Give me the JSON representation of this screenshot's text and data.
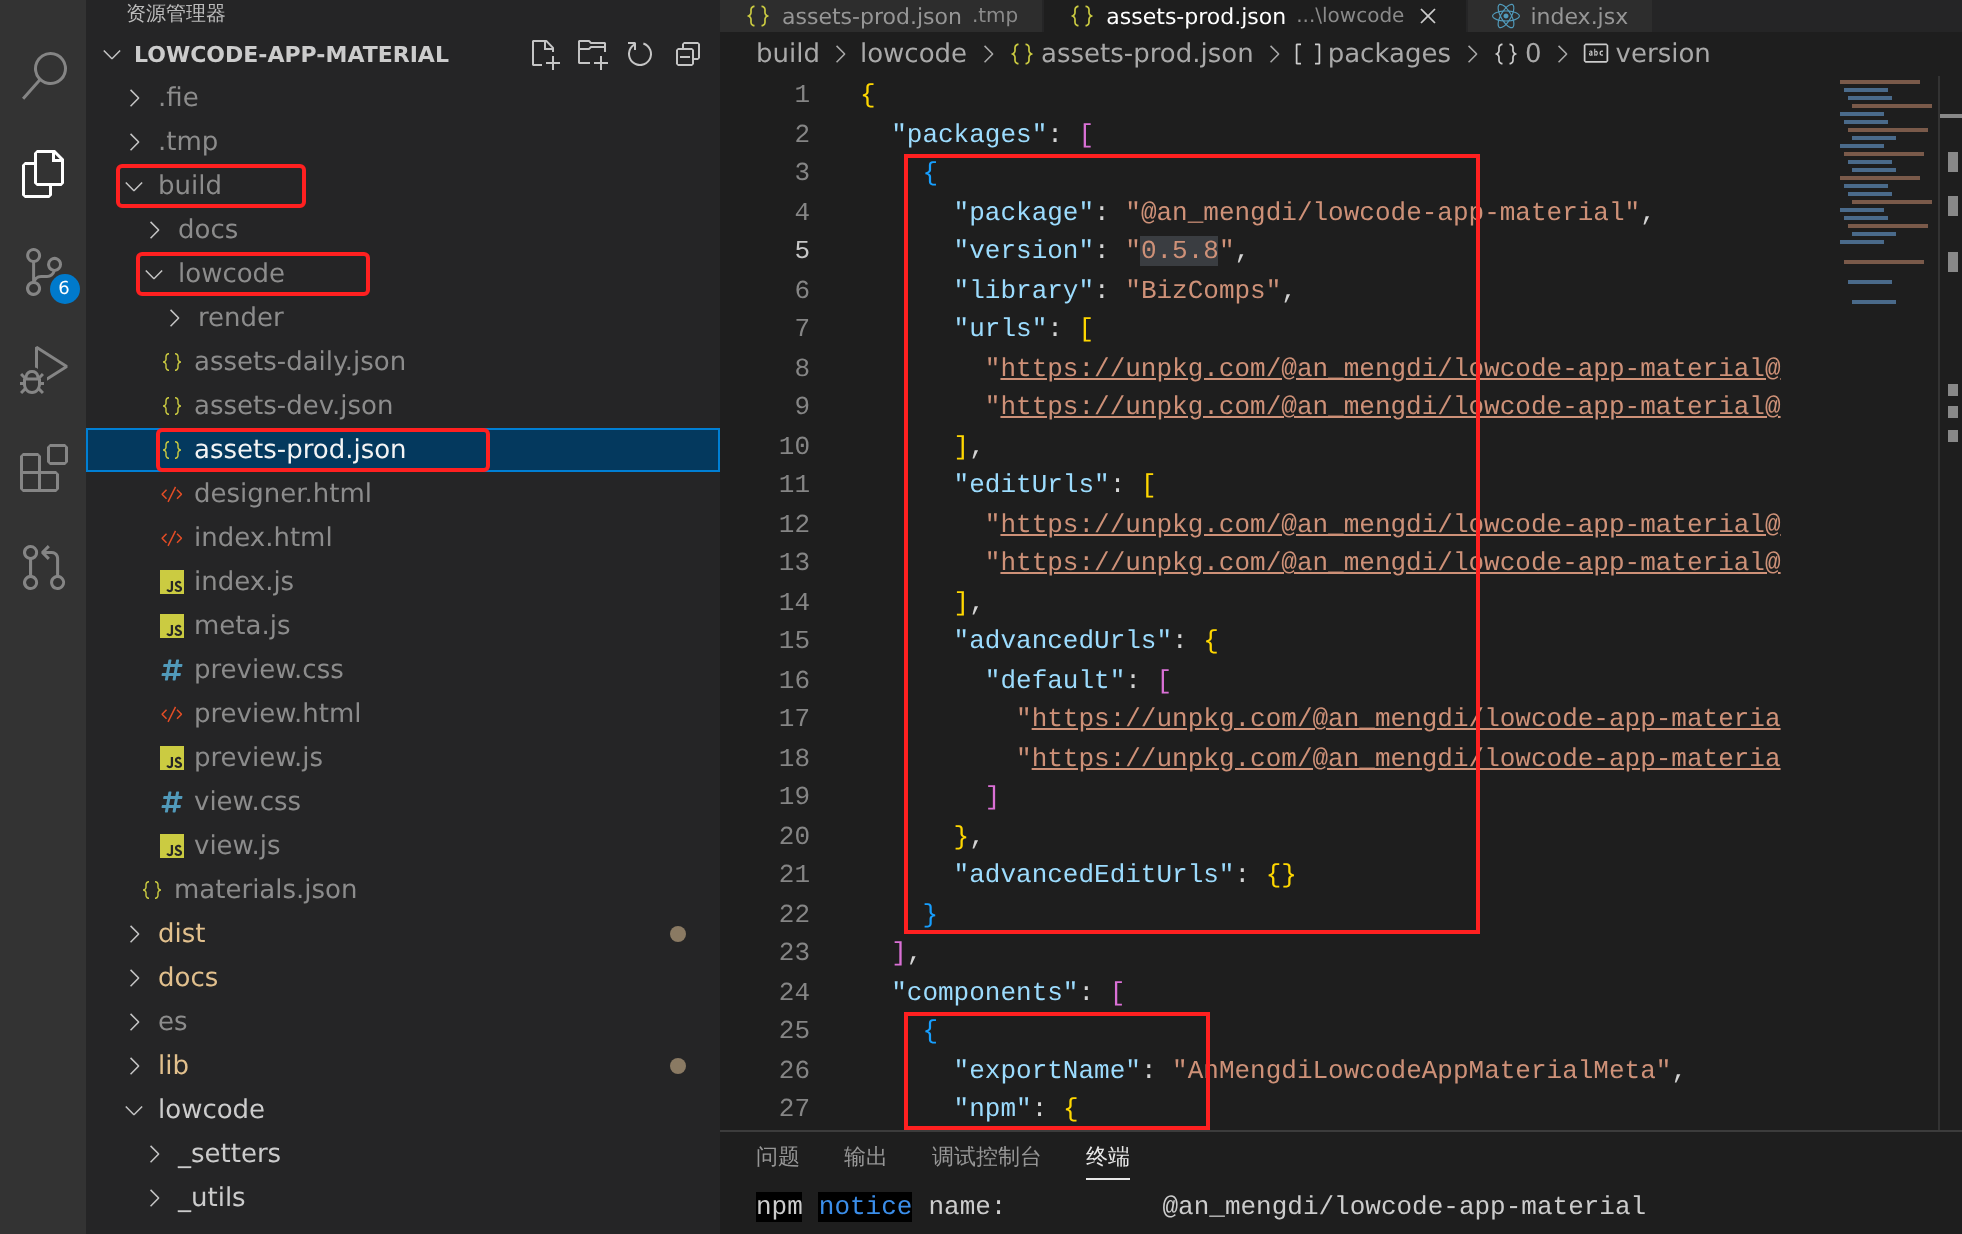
{
  "sidebar": {
    "title": "资源管理器",
    "project": "LOWCODE-APP-MATERIAL",
    "tree": [
      {
        "name": ".fie",
        "kind": "folder",
        "expanded": false,
        "greyed": true,
        "modified": false,
        "selected": false,
        "framed": false,
        "dot": false
      },
      {
        "name": ".tmp",
        "kind": "folder",
        "expanded": false,
        "greyed": true,
        "modified": false,
        "selected": false,
        "framed": false,
        "dot": false
      },
      {
        "name": "build",
        "kind": "folder",
        "expanded": true,
        "greyed": true,
        "modified": false,
        "selected": false,
        "framed": true,
        "dot": false,
        "children": [
          {
            "name": "docs",
            "kind": "folder",
            "expanded": false,
            "greyed": true,
            "modified": false,
            "selected": false,
            "framed": false,
            "dot": false
          },
          {
            "name": "lowcode",
            "kind": "folder",
            "expanded": true,
            "greyed": true,
            "modified": false,
            "selected": false,
            "framed": true,
            "dot": false,
            "children": [
              {
                "name": "render",
                "kind": "folder",
                "expanded": false,
                "greyed": true,
                "modified": false,
                "selected": false,
                "framed": false,
                "dot": false
              },
              {
                "name": "assets-daily.json",
                "kind": "json",
                "greyed": true,
                "modified": false,
                "selected": false,
                "framed": false,
                "dot": false
              },
              {
                "name": "assets-dev.json",
                "kind": "json",
                "greyed": true,
                "modified": false,
                "selected": false,
                "framed": false,
                "dot": false
              },
              {
                "name": "assets-prod.json",
                "kind": "json",
                "greyed": true,
                "modified": false,
                "selected": true,
                "framed": true,
                "dot": false
              },
              {
                "name": "designer.html",
                "kind": "html",
                "greyed": true,
                "modified": false,
                "selected": false,
                "framed": false,
                "dot": false
              },
              {
                "name": "index.html",
                "kind": "html",
                "greyed": true,
                "modified": false,
                "selected": false,
                "framed": false,
                "dot": false
              },
              {
                "name": "index.js",
                "kind": "js",
                "greyed": true,
                "modified": false,
                "selected": false,
                "framed": false,
                "dot": false
              },
              {
                "name": "meta.js",
                "kind": "js",
                "greyed": true,
                "modified": false,
                "selected": false,
                "framed": false,
                "dot": false
              },
              {
                "name": "preview.css",
                "kind": "css",
                "greyed": true,
                "modified": false,
                "selected": false,
                "framed": false,
                "dot": false
              },
              {
                "name": "preview.html",
                "kind": "html",
                "greyed": true,
                "modified": false,
                "selected": false,
                "framed": false,
                "dot": false
              },
              {
                "name": "preview.js",
                "kind": "js",
                "greyed": true,
                "modified": false,
                "selected": false,
                "framed": false,
                "dot": false
              },
              {
                "name": "view.css",
                "kind": "css",
                "greyed": true,
                "modified": false,
                "selected": false,
                "framed": false,
                "dot": false
              },
              {
                "name": "view.js",
                "kind": "js",
                "greyed": true,
                "modified": false,
                "selected": false,
                "framed": false,
                "dot": false
              }
            ]
          },
          {
            "name": "materials.json",
            "kind": "json",
            "greyed": true,
            "modified": false,
            "selected": false,
            "framed": false,
            "dot": false
          }
        ]
      },
      {
        "name": "dist",
        "kind": "folder",
        "expanded": false,
        "greyed": false,
        "modified": true,
        "selected": false,
        "framed": false,
        "dot": true
      },
      {
        "name": "docs",
        "kind": "folder",
        "expanded": false,
        "greyed": false,
        "modified": true,
        "selected": false,
        "framed": false,
        "dot": false
      },
      {
        "name": "es",
        "kind": "folder",
        "expanded": false,
        "greyed": true,
        "modified": false,
        "selected": false,
        "framed": false,
        "dot": false
      },
      {
        "name": "lib",
        "kind": "folder",
        "expanded": false,
        "greyed": false,
        "modified": true,
        "selected": false,
        "framed": false,
        "dot": true
      },
      {
        "name": "lowcode",
        "kind": "folder",
        "expanded": true,
        "greyed": false,
        "modified": false,
        "selected": false,
        "framed": false,
        "dot": false,
        "children": [
          {
            "name": "_setters",
            "kind": "folder",
            "expanded": false,
            "greyed": false,
            "modified": false,
            "selected": false,
            "framed": false,
            "dot": false
          },
          {
            "name": "_utils",
            "kind": "folder",
            "expanded": false,
            "greyed": false,
            "modified": false,
            "selected": false,
            "framed": false,
            "dot": false
          }
        ]
      }
    ]
  },
  "activity_bar": [
    {
      "kind": "search",
      "selected": false
    },
    {
      "kind": "files",
      "selected": true
    },
    {
      "kind": "source-control",
      "selected": false,
      "badge": "6"
    },
    {
      "kind": "debug",
      "selected": false
    },
    {
      "kind": "extensions",
      "selected": false
    },
    {
      "kind": "git-graph",
      "selected": false
    }
  ],
  "tabs": [
    {
      "kind": "json",
      "label": "assets-prod.json",
      "description": ".tmp",
      "selected": false
    },
    {
      "kind": "json",
      "label": "assets-prod.json",
      "description": "...\\lowcode",
      "selected": true
    },
    {
      "kind": "react",
      "label": "index.jsx",
      "selected": false
    }
  ],
  "breadcrumb": [
    {
      "kind": "folder",
      "label": "build"
    },
    {
      "kind": "folder",
      "label": "lowcode"
    },
    {
      "kind": "json",
      "label": "assets-prod.json"
    },
    {
      "kind": "array",
      "label": "packages"
    },
    {
      "kind": "object",
      "label": "0"
    },
    {
      "kind": "string",
      "label": "version"
    }
  ],
  "code_lines": [
    {
      "number": "1",
      "current": false,
      "framed": false,
      "tokens": [
        {
          "kind": "bracket",
          "text": "{",
          "color": "#ffd700"
        }
      ]
    },
    {
      "number": "2",
      "current": false,
      "framed": false,
      "tokens": [
        {
          "kind": "key",
          "text": "  \"packages\""
        },
        {
          "kind": "punct",
          "text": ": "
        },
        {
          "kind": "bracket",
          "text": "[",
          "color": "#da70d6"
        }
      ]
    },
    {
      "number": "3",
      "current": false,
      "framed": true,
      "tokens": [
        {
          "kind": "bracket",
          "text": "    {",
          "color": "#179fff"
        }
      ]
    },
    {
      "number": "4",
      "current": false,
      "framed": true,
      "tokens": [
        {
          "kind": "key",
          "text": "      \"package\""
        },
        {
          "kind": "punct",
          "text": ": "
        },
        {
          "kind": "string",
          "text": "\"@an_mengdi/lowcode-app-material\""
        },
        {
          "kind": "punct",
          "text": ","
        }
      ]
    },
    {
      "number": "5",
      "current": true,
      "framed": true,
      "tokens": [
        {
          "kind": "key",
          "text": "      \"version\""
        },
        {
          "kind": "punct",
          "text": ": "
        },
        {
          "kind": "string",
          "text": "\""
        },
        {
          "kind": "highlight",
          "text": "0.5.8"
        },
        {
          "kind": "string",
          "text": "\""
        },
        {
          "kind": "punct",
          "text": ","
        }
      ]
    },
    {
      "number": "6",
      "current": false,
      "framed": true,
      "tokens": [
        {
          "kind": "key",
          "text": "      \"library\""
        },
        {
          "kind": "punct",
          "text": ": "
        },
        {
          "kind": "string",
          "text": "\"BizComps\""
        },
        {
          "kind": "punct",
          "text": ","
        }
      ]
    },
    {
      "number": "7",
      "current": false,
      "framed": true,
      "tokens": [
        {
          "kind": "key",
          "text": "      \"urls\""
        },
        {
          "kind": "punct",
          "text": ": "
        },
        {
          "kind": "bracket",
          "text": "[",
          "color": "#ffd700"
        }
      ]
    },
    {
      "number": "8",
      "current": false,
      "framed": true,
      "tokens": [
        {
          "kind": "string",
          "text": "        \""
        },
        {
          "kind": "link",
          "text": "https://unpkg.com/@an_mengdi/lowcode-app-material@"
        }
      ]
    },
    {
      "number": "9",
      "current": false,
      "framed": true,
      "tokens": [
        {
          "kind": "string",
          "text": "        \""
        },
        {
          "kind": "link",
          "text": "https://unpkg.com/@an_mengdi/lowcode-app-material@"
        }
      ]
    },
    {
      "number": "10",
      "current": false,
      "framed": true,
      "tokens": [
        {
          "kind": "bracket",
          "text": "      ]",
          "color": "#ffd700"
        },
        {
          "kind": "punct",
          "text": ","
        }
      ]
    },
    {
      "number": "11",
      "current": false,
      "framed": true,
      "tokens": [
        {
          "kind": "key",
          "text": "      \"editUrls\""
        },
        {
          "kind": "punct",
          "text": ": "
        },
        {
          "kind": "bracket",
          "text": "[",
          "color": "#ffd700"
        }
      ]
    },
    {
      "number": "12",
      "current": false,
      "framed": true,
      "tokens": [
        {
          "kind": "string",
          "text": "        \""
        },
        {
          "kind": "link",
          "text": "https://unpkg.com/@an_mengdi/lowcode-app-material@"
        }
      ]
    },
    {
      "number": "13",
      "current": false,
      "framed": true,
      "tokens": [
        {
          "kind": "string",
          "text": "        \""
        },
        {
          "kind": "link",
          "text": "https://unpkg.com/@an_mengdi/lowcode-app-material@"
        }
      ]
    },
    {
      "number": "14",
      "current": false,
      "framed": true,
      "tokens": [
        {
          "kind": "bracket",
          "text": "      ]",
          "color": "#ffd700"
        },
        {
          "kind": "punct",
          "text": ","
        }
      ]
    },
    {
      "number": "15",
      "current": false,
      "framed": true,
      "tokens": [
        {
          "kind": "key",
          "text": "      \"advancedUrls\""
        },
        {
          "kind": "punct",
          "text": ": "
        },
        {
          "kind": "bracket",
          "text": "{",
          "color": "#ffd700"
        }
      ]
    },
    {
      "number": "16",
      "current": false,
      "framed": true,
      "tokens": [
        {
          "kind": "key",
          "text": "        \"default\""
        },
        {
          "kind": "punct",
          "text": ": "
        },
        {
          "kind": "bracket",
          "text": "[",
          "color": "#da70d6"
        }
      ]
    },
    {
      "number": "17",
      "current": false,
      "framed": true,
      "tokens": [
        {
          "kind": "string",
          "text": "          \""
        },
        {
          "kind": "link",
          "text": "https://unpkg.com/@an_mengdi/lowcode-app-materia"
        }
      ]
    },
    {
      "number": "18",
      "current": false,
      "framed": true,
      "tokens": [
        {
          "kind": "string",
          "text": "          \""
        },
        {
          "kind": "link",
          "text": "https://unpkg.com/@an_mengdi/lowcode-app-materia"
        }
      ]
    },
    {
      "number": "19",
      "current": false,
      "framed": true,
      "tokens": [
        {
          "kind": "bracket",
          "text": "        ]",
          "color": "#da70d6"
        }
      ]
    },
    {
      "number": "20",
      "current": false,
      "framed": true,
      "tokens": [
        {
          "kind": "bracket",
          "text": "      }",
          "color": "#ffd700"
        },
        {
          "kind": "punct",
          "text": ","
        }
      ]
    },
    {
      "number": "21",
      "current": false,
      "framed": true,
      "tokens": [
        {
          "kind": "key",
          "text": "      \"advancedEditUrls\""
        },
        {
          "kind": "punct",
          "text": ": "
        },
        {
          "kind": "bracket",
          "text": "{}",
          "color": "#ffd700"
        }
      ]
    },
    {
      "number": "22",
      "current": false,
      "framed": true,
      "tokens": [
        {
          "kind": "bracket",
          "text": "    }",
          "color": "#179fff"
        }
      ]
    },
    {
      "number": "23",
      "current": false,
      "framed": false,
      "tokens": [
        {
          "kind": "bracket",
          "text": "  ]",
          "color": "#da70d6"
        },
        {
          "kind": "punct",
          "text": ","
        }
      ]
    },
    {
      "number": "24",
      "current": false,
      "framed": false,
      "tokens": [
        {
          "kind": "key",
          "text": "  \"components\""
        },
        {
          "kind": "punct",
          "text": ": "
        },
        {
          "kind": "bracket",
          "text": "[",
          "color": "#da70d6"
        }
      ]
    },
    {
      "number": "25",
      "current": false,
      "framed": true,
      "tokens": [
        {
          "kind": "bracket",
          "text": "    {",
          "color": "#179fff"
        }
      ]
    },
    {
      "number": "26",
      "current": false,
      "framed": true,
      "tokens": [
        {
          "kind": "key",
          "text": "      \"exportName\""
        },
        {
          "kind": "punct",
          "text": ": "
        },
        {
          "kind": "string",
          "text": "\"AnMengdiLowcodeAppMaterialMeta\""
        },
        {
          "kind": "punct",
          "text": ","
        }
      ]
    },
    {
      "number": "27",
      "current": false,
      "framed": true,
      "tokens": [
        {
          "kind": "key",
          "text": "      \"npm\""
        },
        {
          "kind": "punct",
          "text": ": "
        },
        {
          "kind": "bracket",
          "text": "{",
          "color": "#ffd700"
        }
      ]
    }
  ],
  "panel": {
    "tabs": [
      {
        "label": "问题",
        "selected": false
      },
      {
        "label": "输出",
        "selected": false
      },
      {
        "label": "调试控制台",
        "selected": false
      },
      {
        "label": "终端",
        "selected": true
      }
    ],
    "terminal_line": [
      {
        "kind": "npm",
        "text": "npm"
      },
      {
        "kind": "notice",
        "text": "notice"
      },
      {
        "kind": "plain",
        "text": "name:"
      },
      {
        "kind": "value",
        "text": "@an_mengdi/lowcode-app-material"
      }
    ]
  }
}
